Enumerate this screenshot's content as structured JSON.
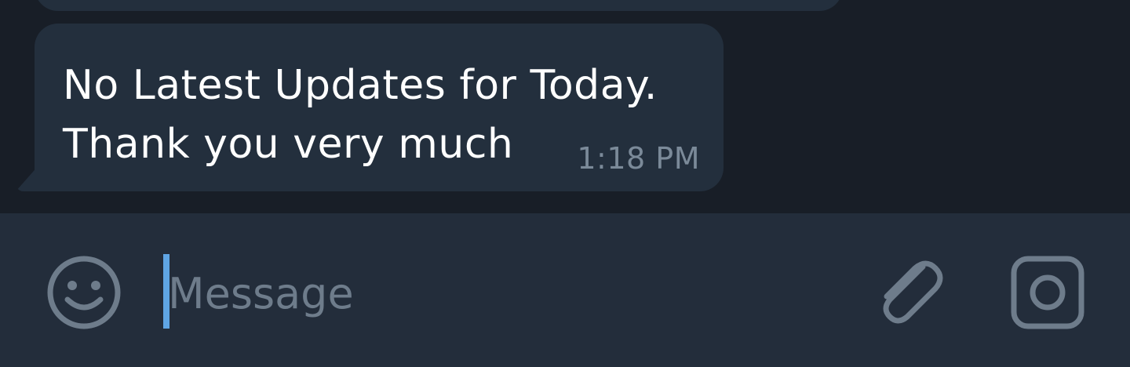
{
  "conversation": {
    "message": {
      "lines": [
        "No Latest Updates for Today.",
        "Thank you very much"
      ],
      "time": "1:18 PM"
    }
  },
  "composer": {
    "placeholder": "Message",
    "emoji_icon": "smiley-face-icon",
    "attach_icon": "paperclip-icon",
    "camera_icon": "camera-icon"
  },
  "colors": {
    "chat_background": "#181e27",
    "bubble": "#232f3d",
    "composer_background": "#232d3b",
    "caret": "#5fa5e4",
    "muted_text": "#7b8a99"
  }
}
